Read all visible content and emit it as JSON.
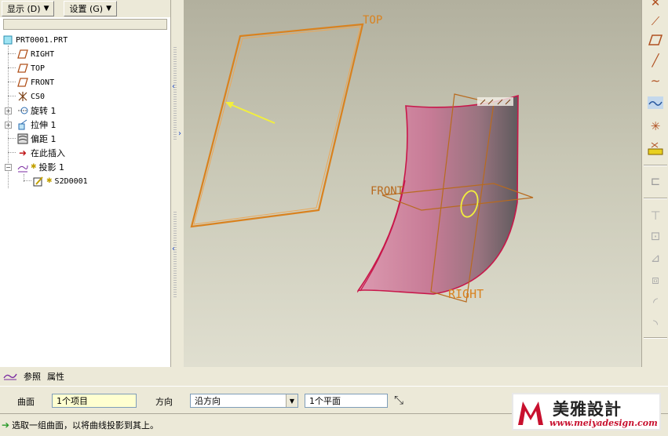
{
  "menu": {
    "display_label": "显示 (D)",
    "settings_label": "设置 (G)"
  },
  "tree": {
    "root": "PRT0001.PRT",
    "items": [
      {
        "label": "RIGHT",
        "icon": "datum-plane-icon"
      },
      {
        "label": "TOP",
        "icon": "datum-plane-icon"
      },
      {
        "label": "FRONT",
        "icon": "datum-plane-icon"
      },
      {
        "label": "CS0",
        "icon": "coordinate-system-icon"
      },
      {
        "label": "旋转 1",
        "icon": "revolve-icon"
      },
      {
        "label": "拉伸 1",
        "icon": "extrude-icon"
      },
      {
        "label": "偏距 1",
        "icon": "offset-icon"
      },
      {
        "label": "在此插入",
        "icon": "insert-here-arrow-icon"
      },
      {
        "label": "投影 1",
        "icon": "projection-icon"
      },
      {
        "label": "S2D0001",
        "icon": "sketch-icon"
      }
    ]
  },
  "viewport": {
    "plane_labels": {
      "top": "TOP",
      "front": "FRONT",
      "right": "RIGHT"
    },
    "colors": {
      "datum_plane": "#d9821f",
      "surface_light": "#d48ba3",
      "surface_dark": "#6e6468",
      "surface_edge": "#c8174a",
      "arrow": "#f2ef3c"
    }
  },
  "toolbar_right": {
    "icons": [
      "datum-axis-icon",
      "datum-point-icon",
      "datum-plane-icon",
      "datum-axis-line-icon",
      "sketch-curve-icon",
      "datum-curve-icon",
      "coordinate-system-icon",
      "analysis-icon",
      "annotation-icon",
      "hole-icon",
      "shell-icon",
      "rib-icon",
      "draft-icon",
      "round-icon",
      "chamfer-icon"
    ]
  },
  "dashboard": {
    "tabs": [
      {
        "label": "参照"
      },
      {
        "label": "属性"
      }
    ],
    "surfaces_label": "曲面",
    "surfaces_value": "1个项目",
    "direction_label": "方向",
    "direction_value": "沿方向",
    "plane_value": "1个平面"
  },
  "status": {
    "message": "选取一组曲面，以将曲线投影到其上。"
  },
  "watermark": {
    "title": "美雅設計",
    "url": "www.meiyadesign.com"
  }
}
